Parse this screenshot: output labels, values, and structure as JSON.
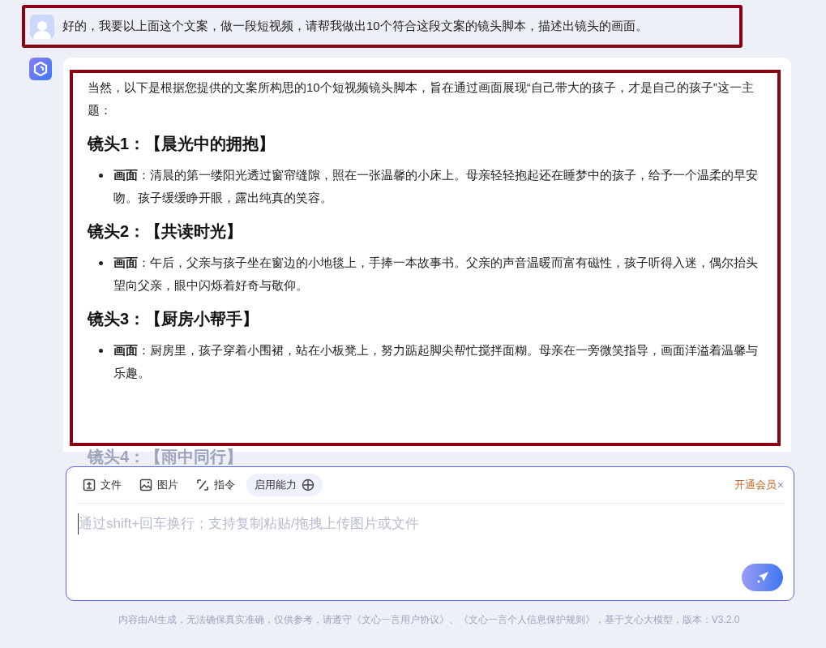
{
  "user_message": {
    "text": "好的，我要以上面这个文案，做一段短视频，请帮我做出10个符合这段文案的镜头脚本，描述出镜头的画面。"
  },
  "answer": {
    "intro": "当然，以下是根据您提供的文案所构思的10个短视频镜头脚本，旨在通过画面展现“自己带大的孩子，才是自己的孩子”这一主题：",
    "shots": [
      {
        "heading": "镜头1：【晨光中的拥抱】",
        "label": "画面",
        "text": "：清晨的第一缕阳光透过窗帘缝隙，照在一张温馨的小床上。母亲轻轻抱起还在睡梦中的孩子，给予一个温柔的早安吻。孩子缓缓睁开眼，露出纯真的笑容。"
      },
      {
        "heading": "镜头2：【共读时光】",
        "label": "画面",
        "text": "：午后，父亲与孩子坐在窗边的小地毯上，手捧一本故事书。父亲的声音温暖而富有磁性，孩子听得入迷，偶尔抬头望向父亲，眼中闪烁着好奇与敬仰。"
      },
      {
        "heading": "镜头3：【厨房小帮手】",
        "label": "画面",
        "text": "：厨房里，孩子穿着小围裙，站在小板凳上，努力踮起脚尖帮忙搅拌面糊。母亲在一旁微笑指导，画面洋溢着温馨与乐趣。"
      }
    ],
    "faded_heading": "镜头4：【雨中同行】"
  },
  "composer": {
    "tools": [
      {
        "kind": "file",
        "label": "文件"
      },
      {
        "kind": "image",
        "label": "图片"
      },
      {
        "kind": "command",
        "label": "指令"
      },
      {
        "kind": "ability",
        "label": "启用能力"
      }
    ],
    "membership": "开通会员",
    "close": "×",
    "placeholder": "通过shift+回车换行；支持复制粘贴/拖拽上传图片或文件"
  },
  "footer": "内容由AI生成，无法确保真实准确，仅供参考，请遵守《文心一言用户协议》、《文心一言个人信息保护规则》，基于文心大模型，版本：V3.2.0"
}
